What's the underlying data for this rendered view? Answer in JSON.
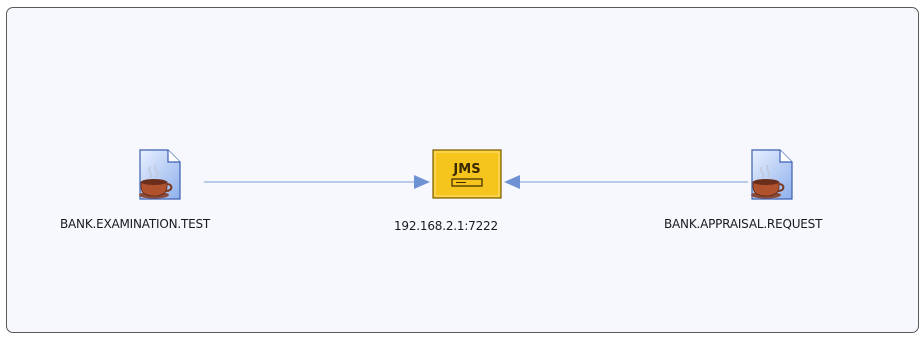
{
  "diagram": {
    "nodes": [
      {
        "id": "left",
        "kind": "destination-file",
        "icon": "java-cup-file-icon",
        "label": "BANK.EXAMINATION.TEST"
      },
      {
        "id": "center",
        "kind": "jms-server",
        "icon": "jms-server-icon",
        "icon_text": "JMS",
        "label": "192.168.2.1:7222"
      },
      {
        "id": "right",
        "kind": "destination-file",
        "icon": "java-cup-file-icon",
        "label": "BANK.APPRAISAL.REQUEST"
      }
    ],
    "edges": [
      {
        "from": "left",
        "to": "center"
      },
      {
        "from": "right",
        "to": "center"
      }
    ]
  },
  "colors": {
    "canvas_bg": "#f6f8fd",
    "edge": "#7e9ed6",
    "jms_fill": "#f5c41d",
    "jms_border": "#7a5c00"
  }
}
